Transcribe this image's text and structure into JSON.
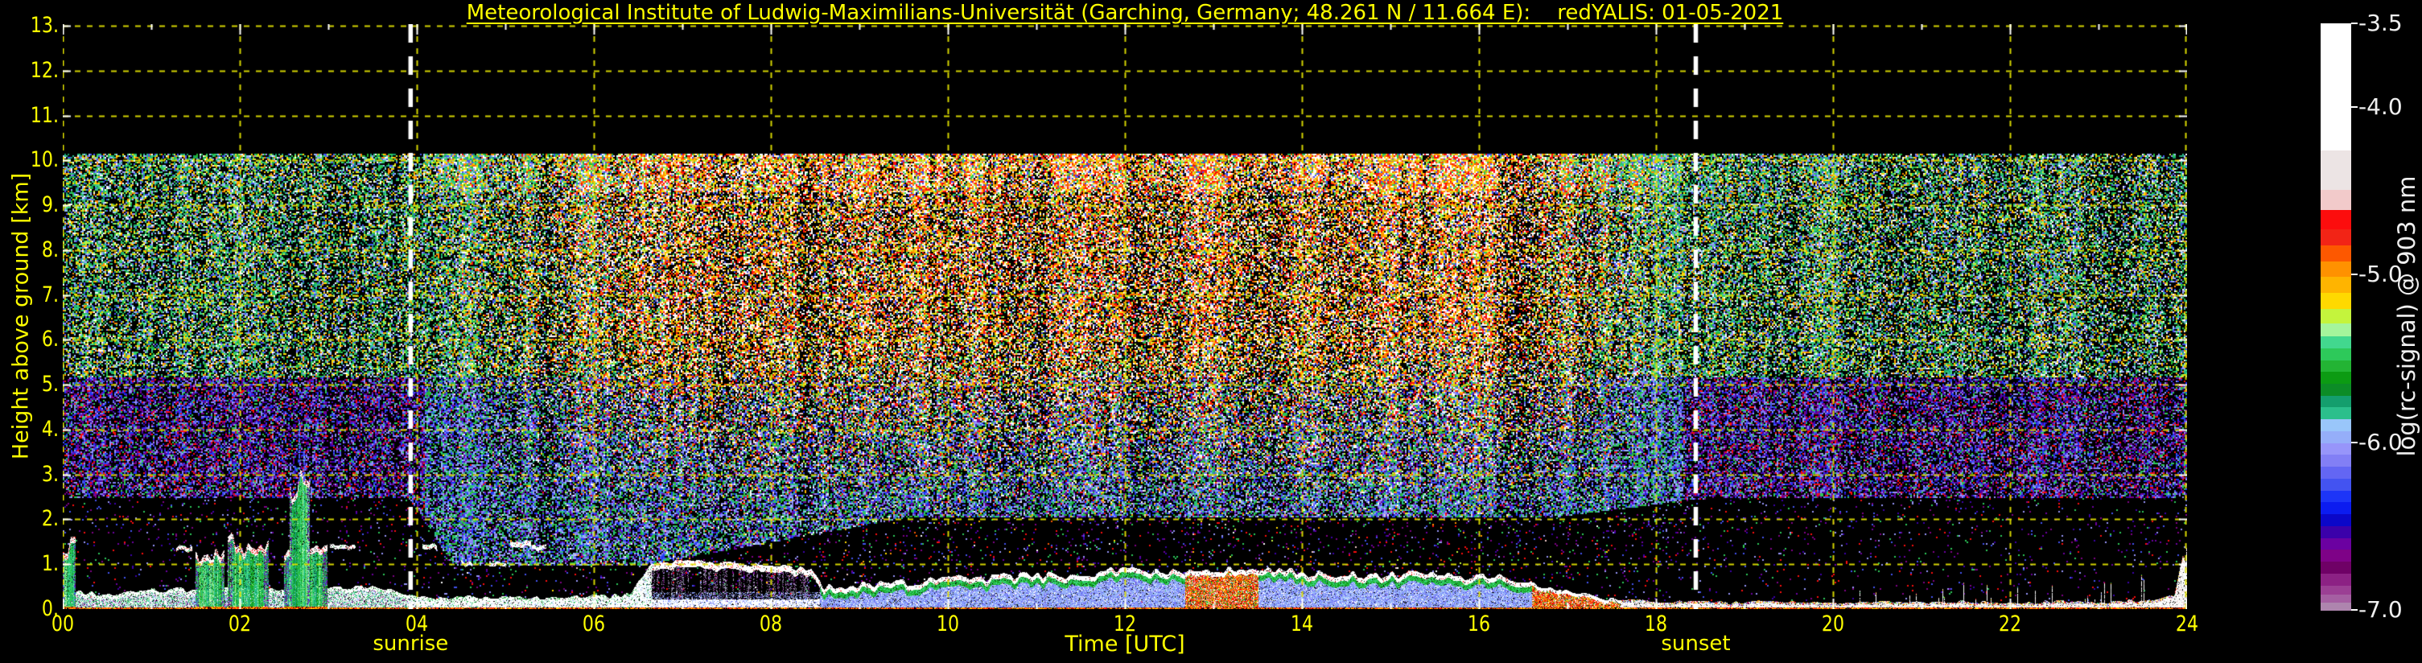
{
  "title": {
    "text": "Meteorological Institute of Ludwig-Maximilians-Universität (Garching, Germany; 48.261 N / 11.664 E):    redYALIS: 01-05-2021",
    "color": "#ffff00"
  },
  "chart_data": {
    "type": "heatmap",
    "title": "Meteorological Institute of Ludwig-Maximilians-Universität (Garching, Germany; 48.261 N / 11.664 E):    redYALIS: 01-05-2021",
    "xlabel": "Time [UTC]",
    "ylabel": "Height above ground [km]",
    "colorbar_label": "log(rc-signal) @ 903 nm",
    "xlim": [
      0,
      24
    ],
    "ylim": [
      0,
      13.04
    ],
    "grid": {
      "on": true,
      "color": "#dede00",
      "dash": [
        7,
        8
      ]
    },
    "x_ticks": [
      {
        "label": "00",
        "hour": 0
      },
      {
        "label": "02",
        "hour": 2
      },
      {
        "label": "04",
        "hour": 4
      },
      {
        "label": "06",
        "hour": 6
      },
      {
        "label": "08",
        "hour": 8
      },
      {
        "label": "10",
        "hour": 10
      },
      {
        "label": "12",
        "hour": 12
      },
      {
        "label": "14",
        "hour": 14
      },
      {
        "label": "16",
        "hour": 16
      },
      {
        "label": "18",
        "hour": 18
      },
      {
        "label": "20",
        "hour": 20
      },
      {
        "label": "22",
        "hour": 22
      },
      {
        "label": "24",
        "hour": 24
      }
    ],
    "x_minor_every_hours": 1,
    "y_ticks": [
      {
        "label": "0.",
        "km": 0
      },
      {
        "label": "1.",
        "km": 1
      },
      {
        "label": "2.",
        "km": 2
      },
      {
        "label": "3.",
        "km": 3
      },
      {
        "label": "4.",
        "km": 4
      },
      {
        "label": "5.",
        "km": 5
      },
      {
        "label": "6.",
        "km": 6
      },
      {
        "label": "7.",
        "km": 7
      },
      {
        "label": "8.",
        "km": 8
      },
      {
        "label": "9.",
        "km": 9
      },
      {
        "label": "10.",
        "km": 10
      },
      {
        "label": "11.",
        "km": 11
      },
      {
        "label": "12.",
        "km": 12
      },
      {
        "label": "13.",
        "km": 13
      }
    ],
    "annotations": {
      "sunrise": {
        "label": "sunrise",
        "hour": 3.93
      },
      "sunset": {
        "label": "sunset",
        "hour": 18.45
      },
      "line_style": {
        "color": "#ffffff",
        "width": 5.5,
        "dash": [
          23,
          17
        ]
      }
    },
    "data_top_km": 10.15,
    "colorbar": {
      "value_top": -3.5,
      "value_bottom": -7.0,
      "ticks": [
        {
          "label": "-3.5",
          "value": -3.5
        },
        {
          "label": "-4.0",
          "value": -4.0
        },
        {
          "label": "-5.0",
          "value": -5.0
        },
        {
          "label": "-6.0",
          "value": -6.0
        },
        {
          "label": "-7.0",
          "value": -7.0
        }
      ],
      "bands": [
        {
          "color": "#ffffff",
          "weight": 161
        },
        {
          "color": "#ece4e4",
          "weight": 50
        },
        {
          "color": "#f2caca",
          "weight": 25
        },
        {
          "color": "#fc0d0d",
          "weight": 25
        },
        {
          "color": "#f22416",
          "weight": 20
        },
        {
          "color": "#fd5800",
          "weight": 20
        },
        {
          "color": "#ff9100",
          "weight": 20
        },
        {
          "color": "#ffb400",
          "weight": 20
        },
        {
          "color": "#ffd900",
          "weight": 20
        },
        {
          "color": "#c4f43c",
          "weight": 19
        },
        {
          "color": "#a5f59b",
          "weight": 16
        },
        {
          "color": "#42d88e",
          "weight": 15
        },
        {
          "color": "#2dc95a",
          "weight": 15
        },
        {
          "color": "#23b434",
          "weight": 15
        },
        {
          "color": "#0c9b13",
          "weight": 15
        },
        {
          "color": "#0c8c26",
          "weight": 15
        },
        {
          "color": "#149e6d",
          "weight": 15
        },
        {
          "color": "#2bbf8c",
          "weight": 15
        },
        {
          "color": "#99c6fa",
          "weight": 15
        },
        {
          "color": "#95aef9",
          "weight": 15
        },
        {
          "color": "#9795fa",
          "weight": 15
        },
        {
          "color": "#827ff5",
          "weight": 15
        },
        {
          "color": "#6366f3",
          "weight": 15
        },
        {
          "color": "#4353f1",
          "weight": 15
        },
        {
          "color": "#1d35f7",
          "weight": 15
        },
        {
          "color": "#0c1cf0",
          "weight": 15
        },
        {
          "color": "#0b07c9",
          "weight": 15
        },
        {
          "color": "#3b01aa",
          "weight": 15
        },
        {
          "color": "#6b01a1",
          "weight": 15
        },
        {
          "color": "#7e0287",
          "weight": 15
        },
        {
          "color": "#6f0166",
          "weight": 15
        },
        {
          "color": "#8c2184",
          "weight": 15
        },
        {
          "color": "#9b3f94",
          "weight": 12
        },
        {
          "color": "#a55fa2",
          "weight": 10
        },
        {
          "color": "#ae85ae",
          "weight": 9
        }
      ]
    },
    "noise": {
      "seed": 20210501,
      "top_km": 10.15,
      "coverage_dense": 0.58,
      "coverage_day_bonus": 0.1,
      "top_band_km": 9.3,
      "gap_coverage": 0.055,
      "gap_top_profile": [
        [
          0,
          2.5
        ],
        [
          3.9,
          2.5
        ],
        [
          4.4,
          1.0
        ],
        [
          6.6,
          1.0
        ],
        [
          9.5,
          2.05
        ],
        [
          16.8,
          2.05
        ],
        [
          18.6,
          2.5
        ],
        [
          24,
          2.5
        ]
      ],
      "sun_transition_h": 0.3,
      "warm_morning_ramp_h": 3.0,
      "warm_evening_fade_start": 18.1,
      "warm_evening_fade_h": 1.6
    },
    "palettes": {
      "warm": [
        "#ffffff",
        "#ffffff",
        "#ffffff",
        "#fd5800",
        "#ff9100",
        "#fc0d0d",
        "#fc0d0d",
        "#ffd900",
        "#f2caca",
        "#ffb400",
        "#c4f43c",
        "#2dc95a",
        "#4353f1"
      ],
      "cool_high": [
        "#2bbf8c",
        "#2dc95a",
        "#42d88e",
        "#c4f43c",
        "#99c6fa",
        "#4353f1",
        "#149e6d",
        "#23b434",
        "#9795fa",
        "#ffd900",
        "#ff8c00",
        "#ffffff"
      ],
      "cool_mid": [
        "#2dc95a",
        "#4353f1",
        "#99c6fa",
        "#2bbf8c",
        "#9795fa",
        "#6b01a1",
        "#1d35f7",
        "#827ff5",
        "#23b434"
      ],
      "night_mid": [
        "#6b01a1",
        "#4353f1",
        "#3b01aa",
        "#9795fa",
        "#7e0287",
        "#2dc95a",
        "#827ff5",
        "#1d35f7",
        "#fc0d0d"
      ],
      "gap": [
        "#6b01a1",
        "#3b01aa",
        "#7e0287",
        "#9795fa",
        "#4353f1",
        "#fc0d0d",
        "#2dc95a"
      ],
      "bl_blue": [
        "#95aef9",
        "#95aef9",
        "#95aef9",
        "#99c6fa",
        "#6366f3",
        "#ffffff",
        "#827ff5"
      ],
      "bl_green": [
        "#2dc95a",
        "#23b434",
        "#42d88e",
        "#0c9b13"
      ],
      "bl_night": [
        "#ffffff",
        "#ffffff",
        "#ffffff",
        "#ffffff",
        "#ffffff",
        "#e0e0e0",
        "#2dc95a",
        "#2bbf8c",
        "#95aef9",
        "#7e0287",
        "#42d88e",
        "#d8d8d8"
      ],
      "bl_red": [
        "#fc0d0d",
        "#fc0d0d",
        "#fd5800",
        "#ff9100",
        "#ffd900",
        "#f22416"
      ],
      "bl_base": [
        "#ff9100",
        "#fd5800",
        "#000000",
        "#fc0d0d",
        "#ffd900"
      ],
      "fog": [
        "#149e6d",
        "#2dc95a",
        "#0c9b13",
        "#2bbf8c",
        "#23b434",
        "#42d88e",
        "#a5f59b"
      ],
      "evening_tip": [
        "#fc0d0d",
        "#2dc95a",
        "#4353f1",
        "#ff9100",
        "#7e0287",
        "#ffd900"
      ],
      "stratus_streak": [
        "#9b8fb0",
        "#8a7ba0",
        "#6b5b8a",
        "#b0a6c4",
        "#7e0287"
      ]
    },
    "boundary_layer": {
      "profile": [
        [
          0,
          0.4
        ],
        [
          0.5,
          0.36
        ],
        [
          1.0,
          0.44
        ],
        [
          1.5,
          0.42
        ],
        [
          2.0,
          0.46
        ],
        [
          2.5,
          0.44
        ],
        [
          3.0,
          0.46
        ],
        [
          3.4,
          0.52
        ],
        [
          3.7,
          0.4
        ],
        [
          3.95,
          0.3
        ],
        [
          4.5,
          0.26
        ],
        [
          5.2,
          0.25
        ],
        [
          5.8,
          0.28
        ],
        [
          6.4,
          0.32
        ],
        [
          6.65,
          1.05
        ],
        [
          7.2,
          1.05
        ],
        [
          7.7,
          1.0
        ],
        [
          8.1,
          0.95
        ],
        [
          8.45,
          0.88
        ],
        [
          8.6,
          0.5
        ],
        [
          9.0,
          0.52
        ],
        [
          9.5,
          0.58
        ],
        [
          10.0,
          0.66
        ],
        [
          10.5,
          0.72
        ],
        [
          11.0,
          0.76
        ],
        [
          11.5,
          0.78
        ],
        [
          12.0,
          0.84
        ],
        [
          12.4,
          0.8
        ],
        [
          12.8,
          0.88
        ],
        [
          13.2,
          0.9
        ],
        [
          13.6,
          0.84
        ],
        [
          14.0,
          0.8
        ],
        [
          14.5,
          0.78
        ],
        [
          15.0,
          0.76
        ],
        [
          15.5,
          0.74
        ],
        [
          16.0,
          0.72
        ],
        [
          16.4,
          0.66
        ],
        [
          16.8,
          0.5
        ],
        [
          17.2,
          0.32
        ],
        [
          17.6,
          0.2
        ],
        [
          18.0,
          0.16
        ],
        [
          19,
          0.15
        ],
        [
          20,
          0.14
        ],
        [
          21,
          0.14
        ],
        [
          22,
          0.15
        ],
        [
          23,
          0.17
        ],
        [
          23.5,
          0.2
        ],
        [
          23.85,
          0.3
        ],
        [
          23.95,
          1.2
        ],
        [
          24,
          0.9
        ]
      ],
      "styles": [
        {
          "from": 0,
          "to": 3.93,
          "style": "night"
        },
        {
          "from": 3.93,
          "to": 6.65,
          "style": "morning"
        },
        {
          "from": 6.65,
          "to": 8.55,
          "style": "stratus"
        },
        {
          "from": 8.55,
          "to": 16.6,
          "style": "convective"
        },
        {
          "from": 16.6,
          "to": 17.6,
          "style": "collapse"
        },
        {
          "from": 17.6,
          "to": 24,
          "style": "evening"
        }
      ],
      "warm_patches": [
        {
          "from": 12.68,
          "to": 13.5
        }
      ],
      "evening_orange_until": 19.4
    },
    "fog_columns": [
      {
        "from": 0.0,
        "to": 0.14,
        "top": 1.55
      },
      {
        "from": 1.5,
        "to": 1.82,
        "top": 1.3
      },
      {
        "from": 1.86,
        "to": 2.32,
        "top": 1.58
      },
      {
        "from": 2.5,
        "to": 2.98,
        "top": 1.35
      },
      {
        "from": 2.56,
        "to": 2.78,
        "top": 2.92
      }
    ],
    "thin_needles": [
      {
        "hour": 2.66,
        "from_km": 2.85,
        "to_km": 4.2
      },
      {
        "hour": 2.72,
        "from_km": 2.85,
        "to_km": 3.55
      }
    ],
    "clouds": [
      {
        "from": 1.28,
        "to": 1.45,
        "km": 1.35,
        "thick": 0.08
      },
      {
        "from": 3.02,
        "to": 3.3,
        "km": 1.38,
        "thick": 0.07
      },
      {
        "from": 4.06,
        "to": 4.22,
        "km": 1.4,
        "thick": 0.09
      },
      {
        "from": 4.5,
        "to": 4.62,
        "km": 1.02,
        "thick": 0.06
      },
      {
        "from": 4.82,
        "to": 5.0,
        "km": 1.0,
        "thick": 0.06
      },
      {
        "from": 5.05,
        "to": 5.28,
        "km": 1.45,
        "thick": 0.1
      },
      {
        "from": 5.3,
        "to": 5.45,
        "km": 1.38,
        "thick": 0.08
      }
    ]
  }
}
